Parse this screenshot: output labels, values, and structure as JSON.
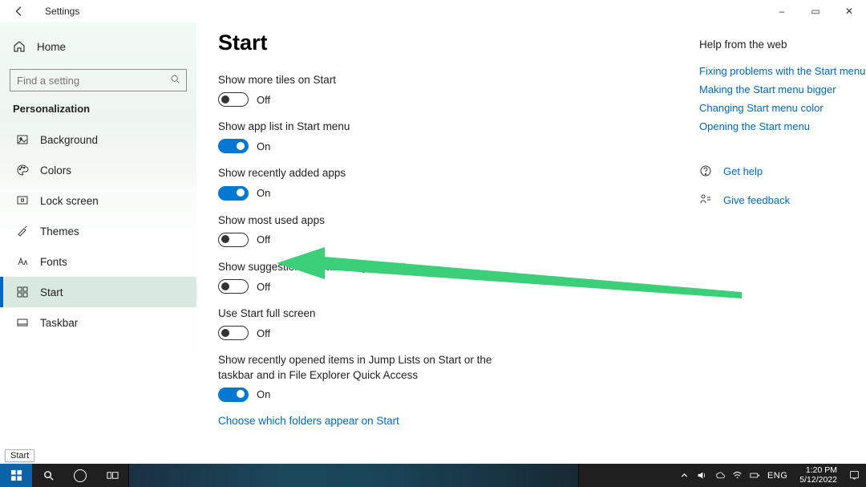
{
  "window": {
    "title": "Settings",
    "min": "–",
    "max": "▭",
    "close": "✕"
  },
  "sidebar": {
    "home_label": "Home",
    "search_placeholder": "Find a setting",
    "category": "Personalization",
    "items": [
      {
        "label": "Background",
        "icon": "image"
      },
      {
        "label": "Colors",
        "icon": "palette"
      },
      {
        "label": "Lock screen",
        "icon": "lock"
      },
      {
        "label": "Themes",
        "icon": "brush"
      },
      {
        "label": "Fonts",
        "icon": "font"
      },
      {
        "label": "Start",
        "icon": "start",
        "selected": true
      },
      {
        "label": "Taskbar",
        "icon": "taskbar"
      }
    ]
  },
  "page": {
    "heading": "Start",
    "choose_link": "Choose which folders appear on Start",
    "labels": {
      "on": "On",
      "off": "Off"
    },
    "settings": [
      {
        "label": "Show more tiles on Start",
        "on": false
      },
      {
        "label": "Show app list in Start menu",
        "on": true
      },
      {
        "label": "Show recently added apps",
        "on": true
      },
      {
        "label": "Show most used apps",
        "on": false
      },
      {
        "label": "Show suggestions occasionally in Start",
        "on": false
      },
      {
        "label": "Use Start full screen",
        "on": false
      },
      {
        "label": "Show recently opened items in Jump Lists on Start or the taskbar and in File Explorer Quick Access",
        "on": true
      }
    ]
  },
  "help": {
    "heading": "Help from the web",
    "links": [
      "Fixing problems with the Start menu",
      "Making the Start menu bigger",
      "Changing Start menu color",
      "Opening the Start menu"
    ],
    "get_help": "Get help",
    "feedback": "Give feedback"
  },
  "tooltip": {
    "start": "Start"
  },
  "taskbar": {
    "ime": "ENG",
    "time": "1:20 PM",
    "date": "5/12/2022"
  }
}
